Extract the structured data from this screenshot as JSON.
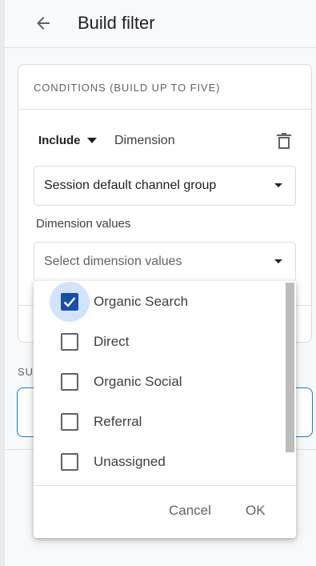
{
  "header": {
    "title": "Build filter",
    "back_icon": "arrow-left-icon"
  },
  "conditions": {
    "title": "CONDITIONS (BUILD UP TO FIVE)",
    "include_label": "Include",
    "dimension_label": "Dimension",
    "delete_icon": "trash-icon",
    "dimension_select_value": "Session default channel group",
    "dimension_values_label": "Dimension values",
    "dimension_values_placeholder": "Select dimension values"
  },
  "section2": {
    "label": "SU"
  },
  "dropdown": {
    "options": [
      {
        "label": "Organic Search",
        "checked": true
      },
      {
        "label": "Direct",
        "checked": false
      },
      {
        "label": "Organic Social",
        "checked": false
      },
      {
        "label": "Referral",
        "checked": false
      },
      {
        "label": "Unassigned",
        "checked": false
      }
    ],
    "cancel_label": "Cancel",
    "ok_label": "OK"
  },
  "colors": {
    "accent": "#1a73e8",
    "checkbox_checked": "#174ea6",
    "checked_halo": "#d2e3fc"
  }
}
